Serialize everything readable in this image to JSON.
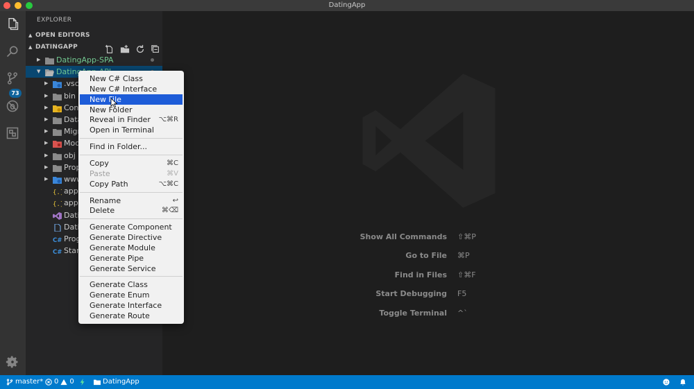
{
  "window": {
    "title": "DatingApp"
  },
  "sidebar": {
    "title": "EXPLORER",
    "open_editors": "OPEN EDITORS",
    "project": "DATINGAPP",
    "tree": [
      {
        "label": "DatingApp-SPA",
        "type": "folder",
        "depth": 1,
        "green": true
      },
      {
        "label": "DatingApp-API",
        "type": "folder-open",
        "depth": 1,
        "green": true,
        "selected": true
      },
      {
        "label": ".vscode",
        "type": "folder-blue",
        "depth": 2
      },
      {
        "label": "bin",
        "type": "folder",
        "depth": 2
      },
      {
        "label": "Controllers",
        "type": "folder-yellow",
        "depth": 2
      },
      {
        "label": "Data",
        "type": "folder",
        "depth": 2
      },
      {
        "label": "Migrations",
        "type": "folder",
        "depth": 2
      },
      {
        "label": "Models",
        "type": "folder-red",
        "depth": 2
      },
      {
        "label": "obj",
        "type": "folder",
        "depth": 2
      },
      {
        "label": "Properties",
        "type": "folder",
        "depth": 2
      },
      {
        "label": "wwwroot",
        "type": "folder-blue",
        "depth": 2
      },
      {
        "label": "appsettings.Development.json",
        "type": "json",
        "depth": 2
      },
      {
        "label": "appsettings.json",
        "type": "json",
        "depth": 2
      },
      {
        "label": "DatingApp.API.csproj",
        "type": "vs",
        "depth": 2
      },
      {
        "label": "DatingApp.db",
        "type": "file",
        "depth": 2
      },
      {
        "label": "Program.cs",
        "type": "cs",
        "depth": 2
      },
      {
        "label": "Startup.cs",
        "type": "cs",
        "depth": 2
      }
    ]
  },
  "activity": {
    "scm_badge": "73"
  },
  "context_menu": {
    "groups": [
      [
        {
          "label": "New C# Class",
          "kb": ""
        },
        {
          "label": "New C# Interface",
          "kb": ""
        },
        {
          "label": "New File",
          "kb": "",
          "highlighted": true
        },
        {
          "label": "New Folder",
          "kb": ""
        },
        {
          "label": "Reveal in Finder",
          "kb": "⌥⌘R"
        },
        {
          "label": "Open in Terminal",
          "kb": ""
        }
      ],
      [
        {
          "label": "Find in Folder...",
          "kb": ""
        }
      ],
      [
        {
          "label": "Copy",
          "kb": "⌘C"
        },
        {
          "label": "Paste",
          "kb": "⌘V",
          "disabled": true
        },
        {
          "label": "Copy Path",
          "kb": "⌥⌘C"
        }
      ],
      [
        {
          "label": "Rename",
          "kb": "↩"
        },
        {
          "label": "Delete",
          "kb": "⌘⌫"
        }
      ],
      [
        {
          "label": "Generate Component",
          "kb": ""
        },
        {
          "label": "Generate Directive",
          "kb": ""
        },
        {
          "label": "Generate Module",
          "kb": ""
        },
        {
          "label": "Generate Pipe",
          "kb": ""
        },
        {
          "label": "Generate Service",
          "kb": ""
        }
      ],
      [
        {
          "label": "Generate Class",
          "kb": ""
        },
        {
          "label": "Generate Enum",
          "kb": ""
        },
        {
          "label": "Generate Interface",
          "kb": ""
        },
        {
          "label": "Generate Route",
          "kb": ""
        }
      ]
    ]
  },
  "editor": {
    "shortcuts": [
      {
        "label": "Show All Commands",
        "keys": "⇧⌘P"
      },
      {
        "label": "Go to File",
        "keys": "⌘P"
      },
      {
        "label": "Find in Files",
        "keys": "⇧⌘F"
      },
      {
        "label": "Start Debugging",
        "keys": "F5"
      },
      {
        "label": "Toggle Terminal",
        "keys": "^`"
      }
    ]
  },
  "statusbar": {
    "branch": "master*",
    "errors": "0",
    "warnings": "0",
    "folder": "DatingApp"
  },
  "colors": {
    "accent": "#007acc",
    "menu_highlight": "#1d5cd8",
    "selection": "#094771",
    "git_green": "#73c991"
  }
}
